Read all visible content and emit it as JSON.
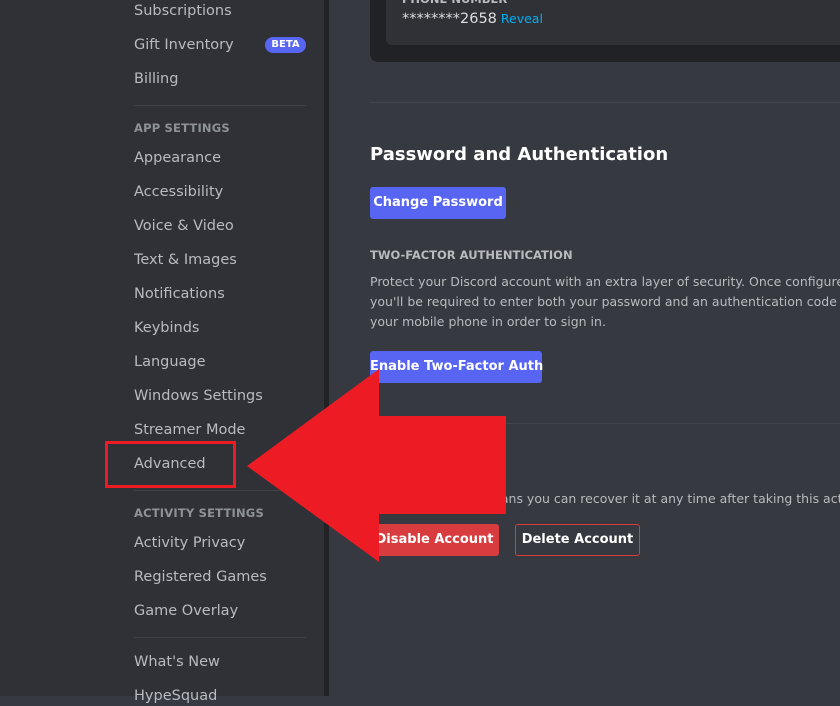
{
  "sidebar": {
    "items_top": [
      {
        "label": "Subscriptions"
      },
      {
        "label": "Gift Inventory",
        "badge": "BETA"
      },
      {
        "label": "Billing"
      }
    ],
    "app_settings_header": "APP SETTINGS",
    "app_settings": [
      {
        "label": "Appearance"
      },
      {
        "label": "Accessibility"
      },
      {
        "label": "Voice & Video"
      },
      {
        "label": "Text & Images"
      },
      {
        "label": "Notifications"
      },
      {
        "label": "Keybinds"
      },
      {
        "label": "Language"
      },
      {
        "label": "Windows Settings"
      },
      {
        "label": "Streamer Mode"
      },
      {
        "label": "Advanced"
      }
    ],
    "activity_settings_header": "ACTIVITY SETTINGS",
    "activity_settings": [
      {
        "label": "Activity Privacy"
      },
      {
        "label": "Registered Games"
      },
      {
        "label": "Game Overlay"
      }
    ],
    "misc": [
      {
        "label": "What's New"
      },
      {
        "label": "HypeSquad"
      }
    ],
    "highlighted_item": "Advanced"
  },
  "main": {
    "phone": {
      "label": "PHONE NUMBER",
      "value": "********2658",
      "reveal_label": "Reveal"
    },
    "password_section": {
      "title": "Password and Authentication",
      "change_password_label": "Change Password",
      "two_factor_header": "TWO-FACTOR AUTHENTICATION",
      "two_factor_description": "Protect your Discord account with an extra layer of security. Once configured, you'll be required to enter both your password and an authentication code from your mobile phone in order to sign in.",
      "enable_2fa_label": "Enable Two-Factor Auth"
    },
    "account_removal": {
      "description_visible": "means you can recover it at any time after taking this action.",
      "disable_label": "Disable Account",
      "delete_label": "Delete Account"
    }
  },
  "annotation": {
    "arrow_color": "#ed1c24",
    "points_to": "Advanced"
  },
  "colors": {
    "accent": "#5865f2",
    "danger": "#d83c3e",
    "link": "#00aff4",
    "annotation_red": "#ed1c24"
  }
}
